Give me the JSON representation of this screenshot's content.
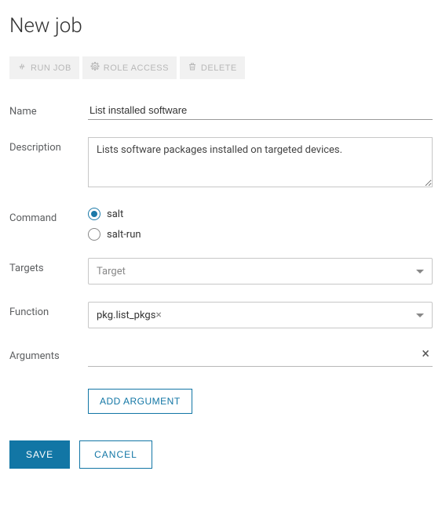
{
  "page_title": "New job",
  "toolbar": {
    "run_job": "RUN JOB",
    "role_access": "ROLE ACCESS",
    "delete": "DELETE"
  },
  "fields": {
    "name": {
      "label": "Name",
      "value": "List installed software"
    },
    "description": {
      "label": "Description",
      "value": "Lists software packages installed on targeted devices."
    },
    "command": {
      "label": "Command",
      "options": [
        "salt",
        "salt-run"
      ],
      "selected": "salt"
    },
    "targets": {
      "label": "Targets",
      "placeholder": "Target"
    },
    "function": {
      "label": "Function",
      "value": "pkg.list_pkgs"
    },
    "arguments": {
      "label": "Arguments",
      "items": [
        ""
      ]
    }
  },
  "buttons": {
    "add_argument": "ADD ARGUMENT",
    "save": "SAVE",
    "cancel": "CANCEL"
  }
}
